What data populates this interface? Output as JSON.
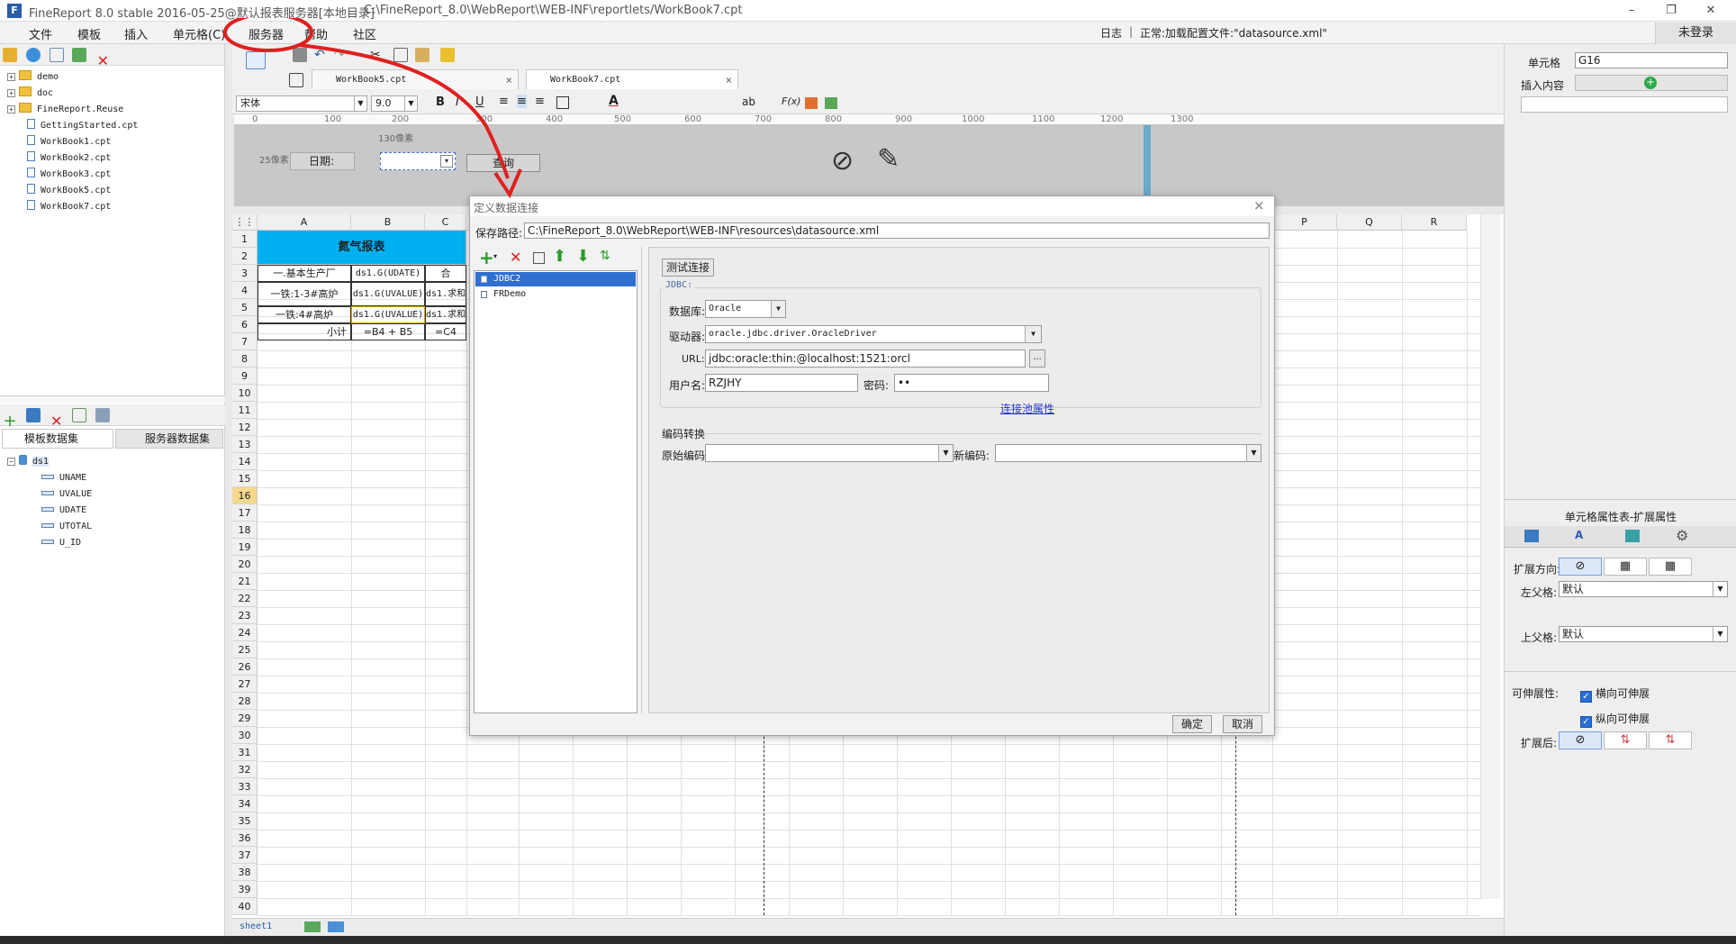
{
  "app": {
    "title": "FineReport 8.0 stable 2016-05-25@默认报表服务器[本地目录]",
    "path": "C:\\FineReport_8.0\\WebReport\\WEB-INF\\reportlets/WorkBook7.cpt",
    "logo": "F"
  },
  "window_controls": {
    "minimize": "–",
    "restore": "❐",
    "close": "✕"
  },
  "menu": [
    "文件",
    "模板",
    "插入",
    "单元格(C)",
    "服务器",
    "帮助",
    "社区"
  ],
  "status": {
    "log": "日志",
    "msg": "正常:加载配置文件:\"datasource.xml\"",
    "login": "未登录"
  },
  "file_tree": [
    "demo",
    "doc",
    "FineReport.Reuse",
    "GettingStarted.cpt",
    "WorkBook1.cpt",
    "WorkBook2.cpt",
    "WorkBook3.cpt",
    "WorkBook5.cpt",
    "WorkBook7.cpt"
  ],
  "dataset": {
    "tabs": [
      "模板数据集",
      "服务器数据集"
    ],
    "name": "ds1",
    "fields": [
      "UNAME",
      "UVALUE",
      "UDATE",
      "UTOTAL",
      "U_ID"
    ]
  },
  "tabs": [
    "WorkBook5.cpt",
    "WorkBook7.cpt"
  ],
  "toolbar": {
    "font": "宋体",
    "size": "9.0"
  },
  "ruler": [
    "0",
    "100",
    "200",
    "300",
    "400",
    "500",
    "600",
    "700",
    "800",
    "900",
    "1000",
    "1100",
    "1200",
    "1300"
  ],
  "param": {
    "width_hint": "130像素",
    "height_hint": "25像素",
    "date_label": "日期:",
    "query": "查询"
  },
  "columns": [
    "A",
    "B",
    "C",
    "P",
    "Q",
    "R"
  ],
  "cells": {
    "r1": "氮气报表",
    "r3a": "一.基本生产厂",
    "r3b": "ds1.G(UDATE)",
    "r3c": "合",
    "r4a": "一铁:1-3#高炉",
    "r4b": "ds1.G(UVALUE)",
    "r4c": "ds1.求和",
    "r5a": "一铁:4#高炉",
    "r5b": "ds1.G(UVALUE)",
    "r5c": "ds1.求和",
    "r6a": "小计",
    "r6b": "=B4 + B5",
    "r6c": "=C4"
  },
  "rows": [
    "1",
    "2",
    "3",
    "4",
    "5",
    "6",
    "7",
    "8",
    "9",
    "10",
    "11",
    "12",
    "13",
    "14",
    "15",
    "16",
    "17",
    "18",
    "19",
    "20",
    "21",
    "22",
    "23",
    "24",
    "25",
    "26",
    "27",
    "28",
    "29",
    "30",
    "31",
    "32",
    "33",
    "34",
    "35",
    "36",
    "37",
    "38",
    "39",
    "40"
  ],
  "sheet": "sheet1",
  "dialog": {
    "title": "定义数据连接",
    "path_label": "保存路径:",
    "path": "C:\\FineReport_8.0\\WebReport\\WEB-INF\\resources\\datasource.xml",
    "connections": [
      "JDBC2",
      "FRDemo"
    ],
    "test_button": "测试连接",
    "jdbc_legend": "JDBC:",
    "db_label": "数据库:",
    "db": "Oracle",
    "driver_label": "驱动器:",
    "driver": "oracle.jdbc.driver.OracleDriver",
    "url_label": "URL:",
    "url": "jdbc:oracle:thin:@localhost:1521:orcl",
    "user_label": "用户名:",
    "user": "RZJHY",
    "pass_label": "密码:",
    "pass": "••",
    "pool_link": "连接池属性",
    "encoding_legend": "编码转换",
    "orig_label": "原始编码:",
    "new_label": "新编码:",
    "ok": "确定",
    "cancel": "取消"
  },
  "right_panel": {
    "cell_label": "单元格",
    "cell_value": "G16",
    "insert_label": "插入内容",
    "section_title": "单元格属性表-扩展属性",
    "expand_dir": "扩展方向:",
    "left_parent": "左父格:",
    "left_parent_val": "默认",
    "top_parent": "上父格:",
    "top_parent_val": "默认",
    "stretch": "可伸展性:",
    "h_stretch": "横向可伸展",
    "v_stretch": "纵向可伸展",
    "after": "扩展后:"
  },
  "colors": {
    "accent": "#2a6fd6",
    "highlight": "#00b0f0",
    "annotation": "#e02020"
  }
}
